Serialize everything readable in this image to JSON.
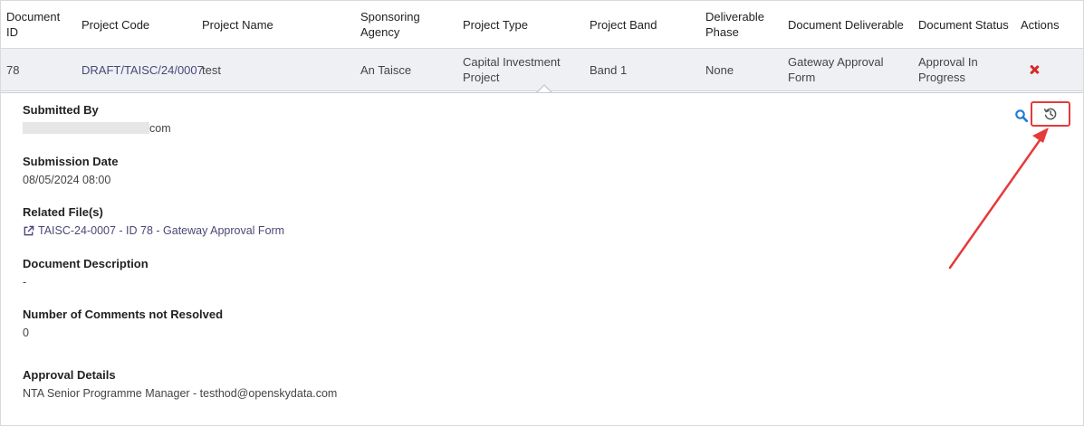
{
  "table": {
    "headers": [
      "Document ID",
      "Project Code",
      "Project Name",
      "Sponsoring Agency",
      "Project Type",
      "Project Band",
      "Deliverable Phase",
      "Document Deliverable",
      "Document Status",
      "Actions"
    ],
    "row": {
      "document_id": "78",
      "project_code": "DRAFT/TAISC/24/0007",
      "project_name": "test",
      "sponsoring_agency": "An Taisce",
      "project_type": "Capital Investment Project",
      "project_band": "Band 1",
      "deliverable_phase": "None",
      "document_deliverable": "Gateway Approval Form",
      "document_status": "Approval In Progress"
    }
  },
  "details": {
    "submitted_by": {
      "label": "Submitted By",
      "value_suffix": "com"
    },
    "submission_date": {
      "label": "Submission Date",
      "value": "08/05/2024 08:00"
    },
    "related_files": {
      "label": "Related File(s)",
      "file_name": "TAISC-24-0007 - ID 78 - Gateway Approval Form"
    },
    "document_description": {
      "label": "Document Description",
      "value": "-"
    },
    "comments_not_resolved": {
      "label": "Number of Comments not Resolved",
      "value": "0"
    },
    "approval_details": {
      "label": "Approval Details",
      "value": "NTA Senior Programme Manager - testhod@openskydata.com"
    }
  },
  "icons": {
    "delete": "close-icon",
    "search": "search-icon",
    "history": "history-icon",
    "external_link": "external-link-icon"
  },
  "colors": {
    "link": "#4a4877",
    "delete": "#d62a2a",
    "search": "#1f7bd8",
    "annotation": "#e53a3a",
    "row_highlight": "#eef0f4"
  }
}
